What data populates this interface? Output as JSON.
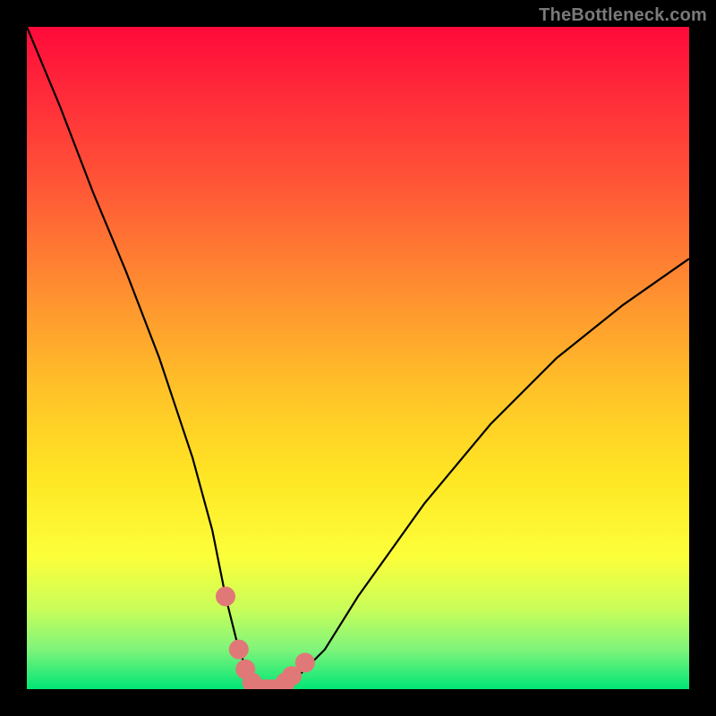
{
  "attribution": "TheBottleneck.com",
  "chart_data": {
    "type": "line",
    "title": "",
    "xlabel": "",
    "ylabel": "",
    "xlim": [
      0,
      100
    ],
    "ylim": [
      0,
      100
    ],
    "curve_main": {
      "name": "bottleneck-curve",
      "x": [
        0,
        5,
        10,
        15,
        20,
        25,
        28,
        30,
        32,
        34,
        36,
        38,
        40,
        45,
        50,
        55,
        60,
        70,
        80,
        90,
        100
      ],
      "y": [
        100,
        88,
        75,
        63,
        50,
        35,
        24,
        14,
        6,
        1,
        0,
        0,
        1,
        6,
        14,
        21,
        28,
        40,
        50,
        58,
        65
      ]
    },
    "markers": {
      "name": "highlight-points",
      "color": "#e17878",
      "x": [
        30,
        32,
        33,
        34,
        35,
        36,
        37,
        38,
        39,
        40,
        42
      ],
      "y": [
        14,
        6,
        3,
        1,
        0,
        0,
        0,
        0,
        1,
        2,
        4
      ]
    },
    "gradient_stops": [
      {
        "pos": 0.0,
        "color": "#ff0a3a"
      },
      {
        "pos": 0.25,
        "color": "#ff5a36"
      },
      {
        "pos": 0.55,
        "color": "#ffc328"
      },
      {
        "pos": 0.8,
        "color": "#fcff3a"
      },
      {
        "pos": 1.0,
        "color": "#00e676"
      }
    ]
  }
}
